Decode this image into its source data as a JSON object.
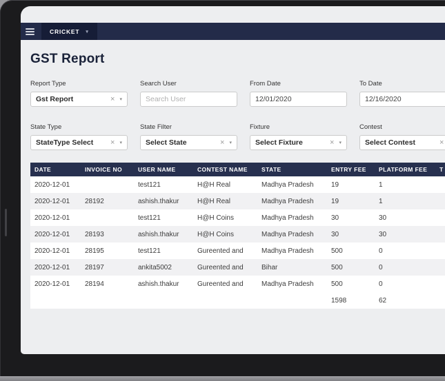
{
  "navbar": {
    "brand": "CRICKET"
  },
  "page": {
    "title": "GST Report"
  },
  "colors": {
    "navbar_bg": "#232b49",
    "brand_button_bg": "#161d37",
    "table_header_bg": "#27304f",
    "page_bg": "#edeef0",
    "row_alt_bg": "#f1f1f3"
  },
  "filters": [
    {
      "name": "report-type",
      "label": "Report Type",
      "type": "select",
      "value": "Gst Report"
    },
    {
      "name": "search-user",
      "label": "Search User",
      "type": "text",
      "placeholder": "Search User",
      "value": ""
    },
    {
      "name": "from-date",
      "label": "From Date",
      "type": "text",
      "value": "12/01/2020"
    },
    {
      "name": "to-date",
      "label": "To Date",
      "type": "text",
      "value": "12/16/2020"
    },
    {
      "name": "state-type",
      "label": "State Type",
      "type": "select",
      "value": "StateType Select"
    },
    {
      "name": "state-filter",
      "label": "State Filter",
      "type": "select",
      "value": "Select State"
    },
    {
      "name": "fixture",
      "label": "Fixture",
      "type": "select",
      "value": "Select Fixture"
    },
    {
      "name": "contest",
      "label": "Contest",
      "type": "select",
      "value": "Select Contest"
    }
  ],
  "icons": {
    "menu": "hamburger",
    "clear": "×",
    "chevron_down": "▾"
  },
  "table": {
    "columns": [
      "DATE",
      "INVOICE NO",
      "USER NAME",
      "CONTEST NAME",
      "STATE",
      "ENTRY FEE",
      "PLATFORM FEE",
      "T"
    ],
    "rows": [
      [
        "2020-12-01",
        "",
        "test121",
        "H@H Real",
        "Madhya Pradesh",
        "19",
        "1",
        ""
      ],
      [
        "2020-12-01",
        "28192",
        "ashish.thakur",
        "H@H Real",
        "Madhya Pradesh",
        "19",
        "1",
        ""
      ],
      [
        "2020-12-01",
        "",
        "test121",
        "H@H Coins",
        "Madhya Pradesh",
        "30",
        "30",
        ""
      ],
      [
        "2020-12-01",
        "28193",
        "ashish.thakur",
        "H@H Coins",
        "Madhya Pradesh",
        "30",
        "30",
        ""
      ],
      [
        "2020-12-01",
        "28195",
        "test121",
        "Gureented and",
        "Madhya Pradesh",
        "500",
        "0",
        ""
      ],
      [
        "2020-12-01",
        "28197",
        "ankita5002",
        "Gureented and",
        "Bihar",
        "500",
        "0",
        ""
      ],
      [
        "2020-12-01",
        "28194",
        "ashish.thakur",
        "Gureented and",
        "Madhya Pradesh",
        "500",
        "0",
        ""
      ]
    ],
    "totals_row": [
      "",
      "",
      "",
      "",
      "",
      "1598",
      "62",
      ""
    ]
  }
}
